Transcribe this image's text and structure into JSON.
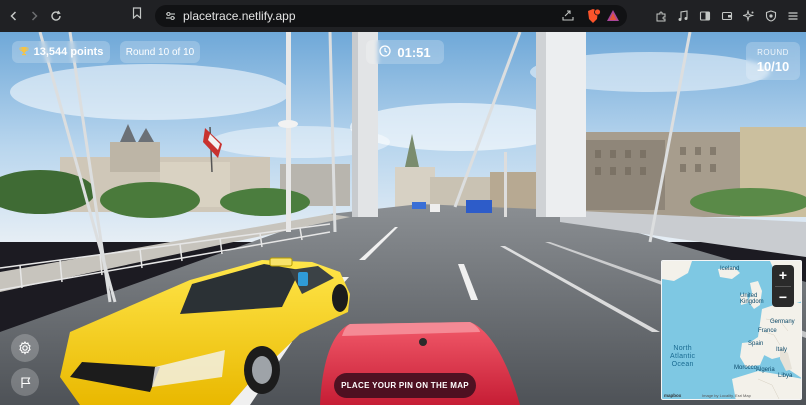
{
  "browser": {
    "url": "placetrace.netlify.app"
  },
  "hud": {
    "points": "13,544 points",
    "round_text": "Round 10 of 10",
    "timer": "01:51",
    "round_label": "ROUND",
    "round_value": "10/10"
  },
  "actions": {
    "place_pin": "PLACE YOUR PIN ON THE MAP"
  },
  "minimap": {
    "labels": {
      "iceland": "Iceland",
      "united_kingdom": "United\nKingdom",
      "germany": "Germany",
      "france": "France",
      "spain": "Spain",
      "italy": "Italy",
      "morocco": "Morocco",
      "algeria": "Algeria",
      "libya": "Libya",
      "ocean": "North\nAtlantic\nOcean"
    },
    "zoom_in": "+",
    "zoom_out": "−",
    "logo": "mapbox",
    "attribution": "Image by Locality, Esri Map"
  },
  "colors": {
    "taxi": "#f6d10a",
    "red_car": "#e8334a",
    "sky": "#9ec8ea",
    "road": "#5a5f66"
  },
  "icons": {
    "back": "arrow-left-icon",
    "forward": "arrow-right-icon",
    "reload": "reload-icon",
    "bookmark": "bookmark-icon",
    "trophy": "trophy-icon",
    "clock": "clock-icon",
    "settings": "gear-icon",
    "report": "flag-icon"
  }
}
